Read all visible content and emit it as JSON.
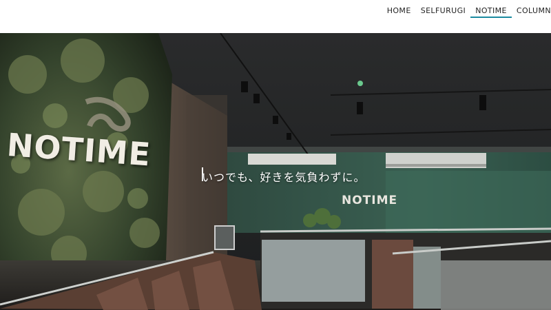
{
  "nav": {
    "items": [
      {
        "label": "HOME",
        "active": false
      },
      {
        "label": "SELFURUGI",
        "active": false
      },
      {
        "label": "NOTIME",
        "active": true
      },
      {
        "label": "COLUMN",
        "active": false
      }
    ],
    "active_color": "#1a8aa0"
  },
  "hero": {
    "tagline": "いつでも、好きを気負わずに。",
    "store_sign": "NOTIME",
    "wall_sign": "NOTIME"
  }
}
